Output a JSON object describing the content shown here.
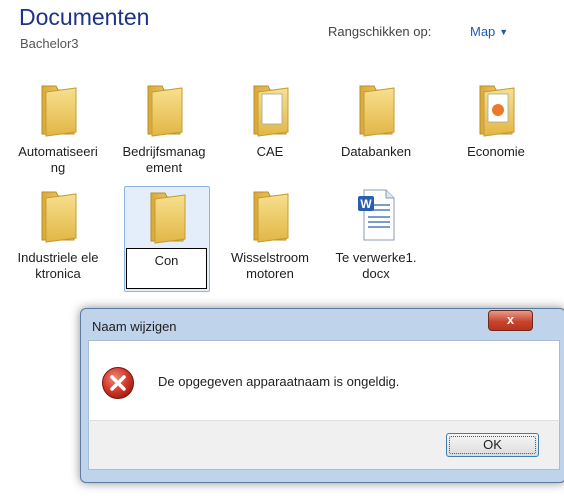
{
  "header": {
    "title": "Documenten",
    "subtitle": "Bachelor3",
    "arrange_label": "Rangschikken op:",
    "arrange_value": "Map"
  },
  "items": [
    {
      "label": "Automatiseering",
      "icon": "folder-icon"
    },
    {
      "label": "Bedrijfsmanagement",
      "icon": "folder-icon"
    },
    {
      "label": "CAE",
      "icon": "folder-icon"
    },
    {
      "label": "Databanken",
      "icon": "folder-icon"
    },
    {
      "label": "Economie",
      "icon": "folder-icon"
    },
    {
      "label": "Industriele elektronica",
      "icon": "folder-icon"
    },
    {
      "label": "Con",
      "icon": "folder-icon",
      "selected": true
    },
    {
      "label": "Wisselstroommotoren",
      "icon": "folder-icon"
    },
    {
      "label": "Te verwerke1.docx",
      "icon": "word-document-icon"
    }
  ],
  "dialog": {
    "title": "Naam wijzigen",
    "close": "x",
    "message": "De opgegeven apparaatnaam is ongeldig.",
    "ok_label": "OK",
    "icon": "error-icon"
  },
  "colors": {
    "title": "#1e3287",
    "link": "#1e5aa8",
    "folder": "#f0cf6b",
    "error": "#c8261c"
  }
}
